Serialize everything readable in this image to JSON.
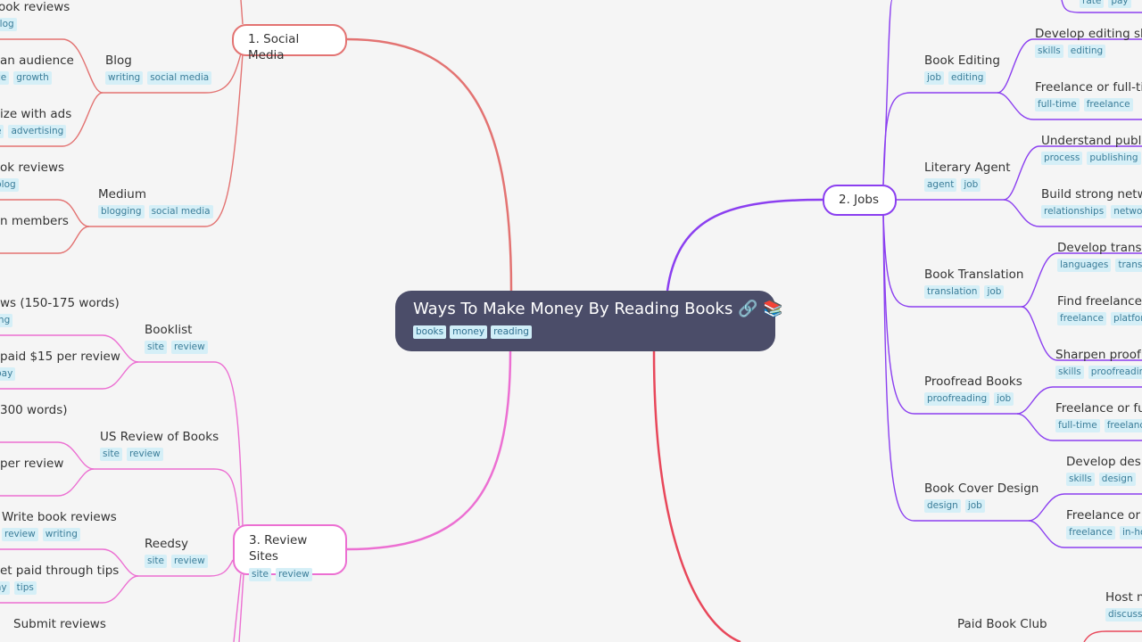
{
  "root": {
    "title": "Ways To Make Money By Reading Books",
    "icons": [
      "link-icon",
      "books-icon"
    ],
    "icon_glyphs": [
      "🔗",
      "📚"
    ],
    "tags": [
      "books",
      "money",
      "reading"
    ]
  },
  "colors": {
    "social": "#e37372",
    "jobs": "#8b3ff0",
    "review": "#ec6fd2",
    "club": "#e8475a",
    "root_bg": "#4b4d69",
    "tag_bg": "#d5eff7",
    "tag_text": "#3b7d99"
  },
  "social_media": {
    "label": "1. Social Media",
    "children": [
      {
        "text": "Blog",
        "tags": [
          "writing",
          "social media"
        ],
        "children": [
          {
            "text": "ook reviews",
            "tags": [
              "blog"
            ]
          },
          {
            "text": "an audience",
            "tags": [
              "ce",
              "growth"
            ]
          },
          {
            "text": "ize with ads",
            "tags": [
              "e",
              "advertising"
            ]
          }
        ]
      },
      {
        "text": "Medium",
        "tags": [
          "blogging",
          "social media"
        ],
        "children": [
          {
            "text": "ok reviews",
            "tags": [
              "blog"
            ]
          },
          {
            "text": "n members",
            "tags": []
          }
        ]
      }
    ]
  },
  "jobs": {
    "label": "2. Jobs",
    "top_tags": [
      "rate",
      "pay"
    ],
    "children": [
      {
        "text": "Book Editing",
        "tags": [
          "job",
          "editing"
        ],
        "children": [
          {
            "text": "Develop editing skill",
            "tags": [
              "skills",
              "editing"
            ]
          },
          {
            "text": "Freelance or full-tim",
            "tags": [
              "full-time",
              "freelance"
            ]
          }
        ]
      },
      {
        "text": "Literary Agent",
        "tags": [
          "agent",
          "job"
        ],
        "children": [
          {
            "text": "Understand publish",
            "tags": [
              "process",
              "publishing"
            ]
          },
          {
            "text": "Build strong netwo",
            "tags": [
              "relationships",
              "network"
            ]
          }
        ]
      },
      {
        "text": "Book Translation",
        "tags": [
          "translation",
          "job"
        ],
        "children": [
          {
            "text": "Develop translat",
            "tags": [
              "languages",
              "translat"
            ]
          },
          {
            "text": "Find freelance w",
            "tags": [
              "freelance",
              "platform"
            ]
          }
        ]
      },
      {
        "text": "Proofread Books",
        "tags": [
          "proofreading",
          "job"
        ],
        "children": [
          {
            "text": "Sharpen proofre",
            "tags": [
              "skills",
              "proofreading"
            ]
          },
          {
            "text": "Freelance or full-",
            "tags": [
              "full-time",
              "freelance"
            ]
          }
        ]
      },
      {
        "text": "Book Cover Design",
        "tags": [
          "design",
          "job"
        ],
        "children": [
          {
            "text": "Develop desig",
            "tags": [
              "skills",
              "design"
            ]
          },
          {
            "text": "Freelance or in",
            "tags": [
              "freelance",
              "in-hou"
            ]
          }
        ]
      }
    ]
  },
  "review_sites": {
    "label": "3. Review Sites",
    "tags": [
      "site",
      "review"
    ],
    "children": [
      {
        "text": "Booklist",
        "tags": [
          "site",
          "review"
        ],
        "children": [
          {
            "text": "ws (150-175 words)",
            "tags": [
              "ing"
            ]
          },
          {
            "text": "paid $15 per review",
            "tags": [
              "pay"
            ]
          }
        ]
      },
      {
        "text": "US Review of Books",
        "tags": [
          "site",
          "review"
        ],
        "children": [
          {
            "text": "300 words)",
            "tags": []
          },
          {
            "text": " per review",
            "tags": []
          }
        ]
      },
      {
        "text": "Reedsy",
        "tags": [
          "site",
          "review"
        ],
        "children": [
          {
            "text": "Write book reviews",
            "tags": [
              "review",
              "writing"
            ]
          },
          {
            "text": "et paid through tips",
            "tags": [
              "ay",
              "tips"
            ]
          },
          {
            "text": "Submit reviews",
            "tags": []
          }
        ]
      }
    ]
  },
  "paid_book_club": {
    "text": "Paid Book Club",
    "tags": [],
    "children": [
      {
        "text": "Host m",
        "tags": [
          "discussi"
        ]
      }
    ]
  }
}
